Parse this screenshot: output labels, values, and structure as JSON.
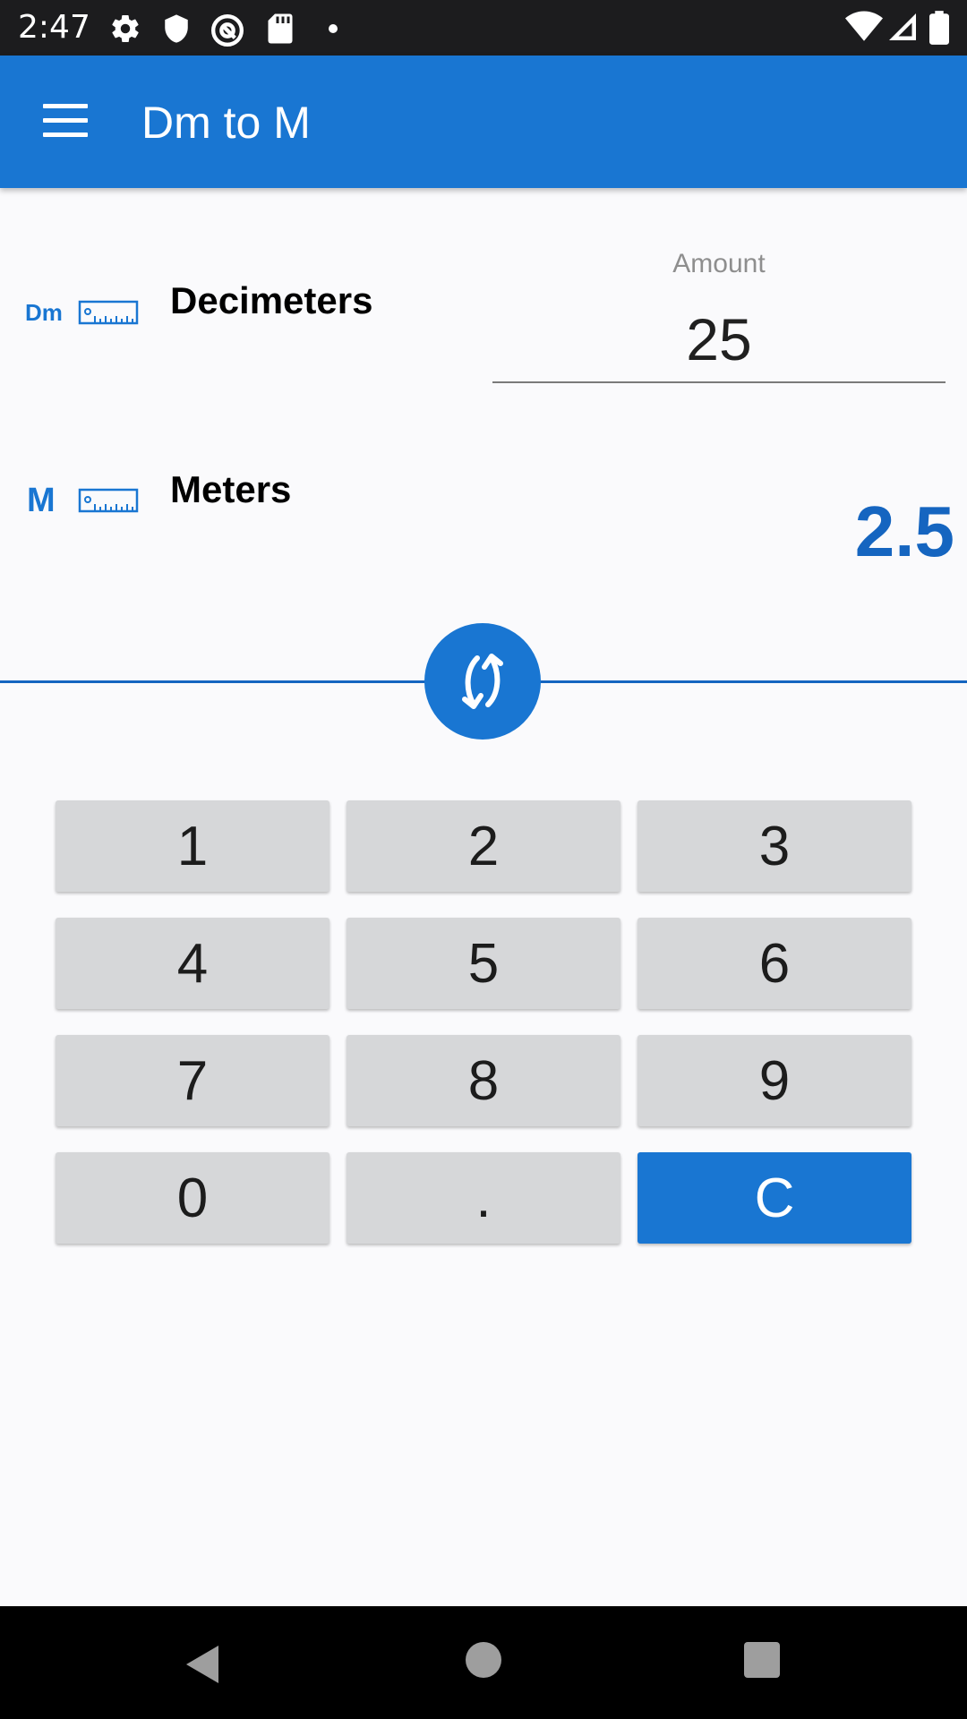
{
  "status_bar": {
    "time": "2:47",
    "left_icons": [
      "gear-icon",
      "shield-icon",
      "at-circle-icon",
      "sd-card-icon",
      "dot-icon"
    ],
    "right_icons": [
      "wifi-icon",
      "signal-icon",
      "battery-icon"
    ]
  },
  "app_bar": {
    "title": "Dm to M",
    "menu_icon": "hamburger-menu-icon"
  },
  "from_unit": {
    "icon_abbr": "Dm",
    "name": "Decimeters",
    "amount_label": "Amount",
    "amount_value": "25"
  },
  "to_unit": {
    "icon_abbr": "M",
    "name": "Meters",
    "result": "2.5"
  },
  "swap_icon": "swap-arrows-icon",
  "keypad": {
    "k1": "1",
    "k2": "2",
    "k3": "3",
    "k4": "4",
    "k5": "5",
    "k6": "6",
    "k7": "7",
    "k8": "8",
    "k9": "9",
    "k0": "0",
    "kdot": ".",
    "kclear": "C"
  },
  "colors": {
    "primary": "#1976d2",
    "result_text": "#1565c0",
    "key_bg": "#d6d7d9"
  }
}
